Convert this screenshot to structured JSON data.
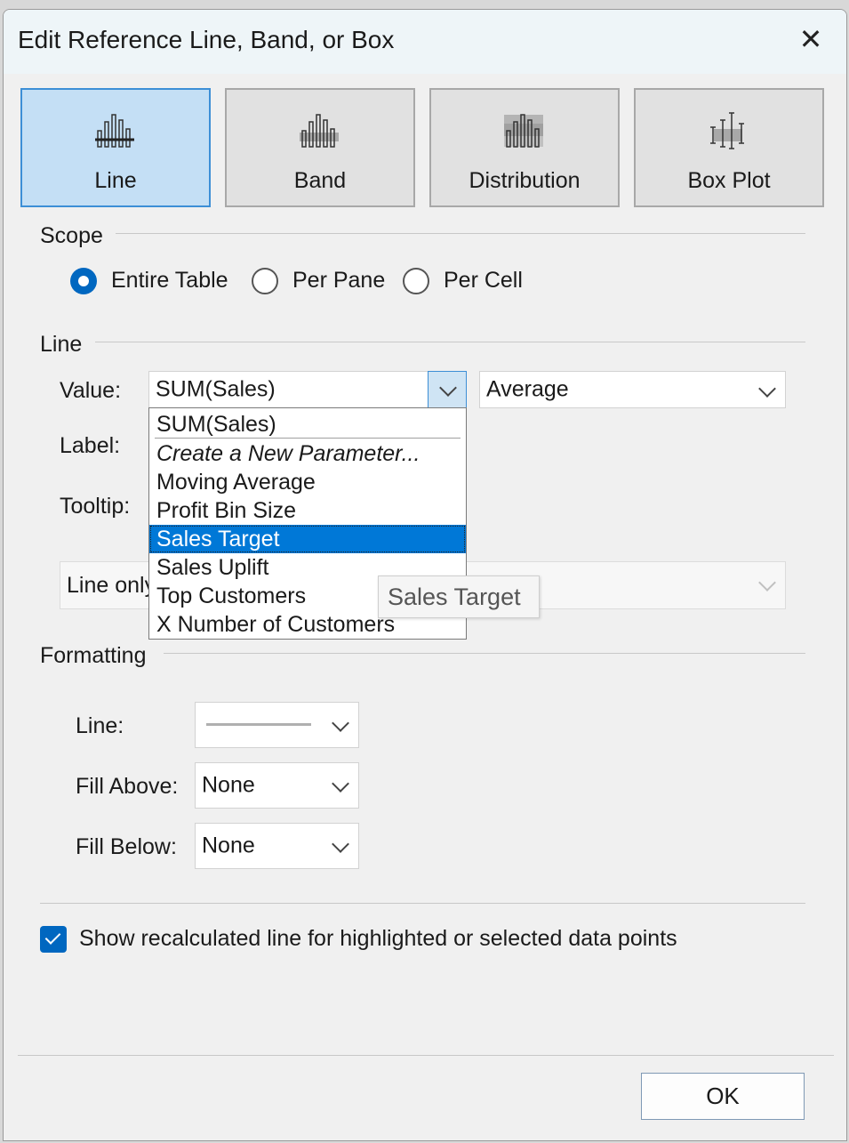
{
  "window": {
    "title": "Edit Reference Line, Band, or Box",
    "close_glyph": "✕"
  },
  "type_tabs": [
    {
      "label": "Line",
      "active": true,
      "icon": "reference-line-icon"
    },
    {
      "label": "Band",
      "active": false,
      "icon": "reference-band-icon"
    },
    {
      "label": "Distribution",
      "active": false,
      "icon": "distribution-icon"
    },
    {
      "label": "Box Plot",
      "active": false,
      "icon": "box-plot-icon"
    }
  ],
  "scope": {
    "label": "Scope",
    "options": [
      {
        "label": "Entire Table",
        "checked": true
      },
      {
        "label": "Per Pane",
        "checked": false
      },
      {
        "label": "Per Cell",
        "checked": false
      }
    ]
  },
  "line_section": {
    "label": "Line",
    "value_label": "Value:",
    "value_selected": "SUM(Sales)",
    "aggregation": "Average",
    "label_label": "Label:",
    "tooltip_label": "Tooltip:",
    "line_mode_partial": "Line only",
    "dropdown_options": [
      {
        "label": "SUM(Sales)",
        "italic": false,
        "selected": false
      },
      {
        "label": "Create a New Parameter...",
        "italic": true,
        "selected": false
      },
      {
        "label": "Moving Average",
        "italic": false,
        "selected": false
      },
      {
        "label": "Profit Bin Size",
        "italic": false,
        "selected": false
      },
      {
        "label": "Sales Target",
        "italic": false,
        "selected": true
      },
      {
        "label": "Sales Uplift",
        "italic": false,
        "selected": false
      },
      {
        "label": "Top Customers",
        "italic": false,
        "selected": false
      },
      {
        "label": "X Number of Customers",
        "italic": false,
        "selected": false
      }
    ],
    "hover_tooltip": "Sales Target"
  },
  "formatting": {
    "label": "Formatting",
    "line_label": "Line:",
    "fill_above_label": "Fill Above:",
    "fill_above_value": "None",
    "fill_below_label": "Fill Below:",
    "fill_below_value": "None"
  },
  "recalc": {
    "label": "Show recalculated line for highlighted or selected data points",
    "checked": true
  },
  "footer": {
    "ok_label": "OK"
  },
  "colors": {
    "accent": "#0067c0",
    "selection": "#0078d7",
    "active_tab": "#c4dff5"
  }
}
